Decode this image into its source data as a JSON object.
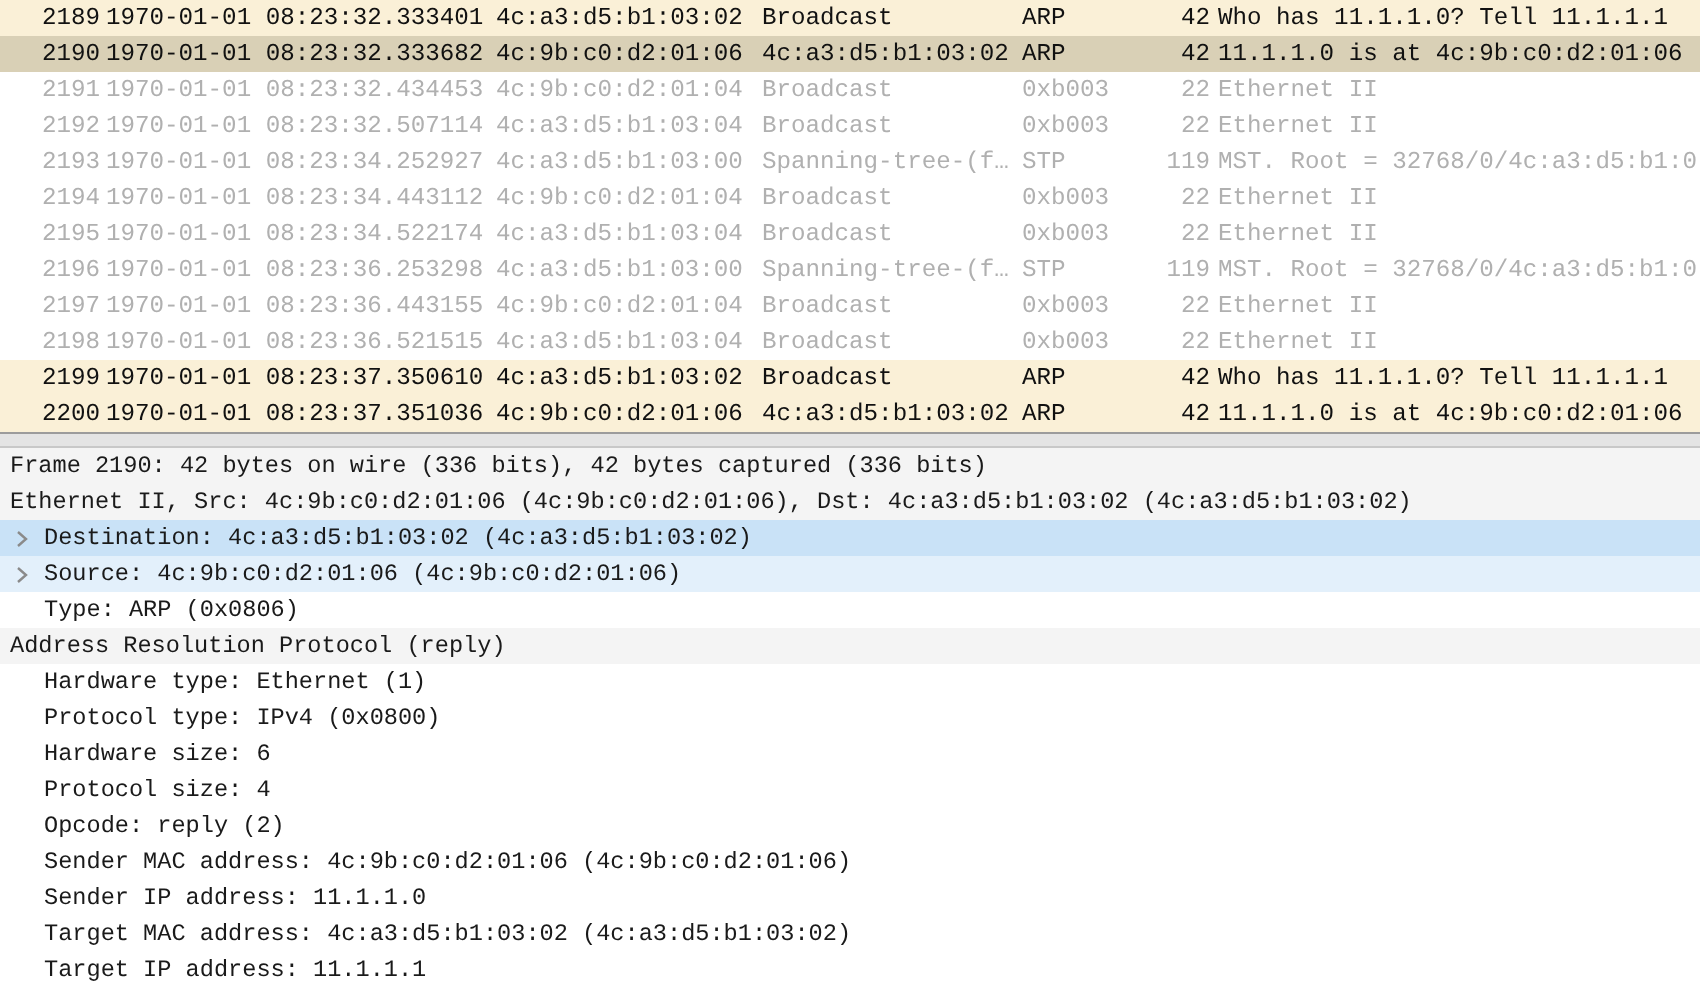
{
  "packet_list": {
    "rows": [
      {
        "no": "2189",
        "time": "1970-01-01 08:23:32.333401",
        "source": "4c:a3:d5:b1:03:02",
        "destination": "Broadcast",
        "protocol": "ARP",
        "length": "42",
        "info": "Who has 11.1.1.0? Tell 11.1.1.1",
        "kind": "arp",
        "selected": false
      },
      {
        "no": "2190",
        "time": "1970-01-01 08:23:32.333682",
        "source": "4c:9b:c0:d2:01:06",
        "destination": "4c:a3:d5:b1:03:02",
        "protocol": "ARP",
        "length": "42",
        "info": "11.1.1.0 is at 4c:9b:c0:d2:01:06",
        "kind": "arp",
        "selected": true
      },
      {
        "no": "2191",
        "time": "1970-01-01 08:23:32.434453",
        "source": "4c:9b:c0:d2:01:04",
        "destination": "Broadcast",
        "protocol": "0xb003",
        "length": "22",
        "info": "Ethernet II",
        "kind": "other",
        "selected": false
      },
      {
        "no": "2192",
        "time": "1970-01-01 08:23:32.507114",
        "source": "4c:a3:d5:b1:03:04",
        "destination": "Broadcast",
        "protocol": "0xb003",
        "length": "22",
        "info": "Ethernet II",
        "kind": "other",
        "selected": false
      },
      {
        "no": "2193",
        "time": "1970-01-01 08:23:34.252927",
        "source": "4c:a3:d5:b1:03:00",
        "destination": "Spanning-tree-(f…",
        "protocol": "STP",
        "length": "119",
        "info": "MST. Root = 32768/0/4c:a3:d5:b1:0",
        "kind": "other",
        "selected": false
      },
      {
        "no": "2194",
        "time": "1970-01-01 08:23:34.443112",
        "source": "4c:9b:c0:d2:01:04",
        "destination": "Broadcast",
        "protocol": "0xb003",
        "length": "22",
        "info": "Ethernet II",
        "kind": "other",
        "selected": false
      },
      {
        "no": "2195",
        "time": "1970-01-01 08:23:34.522174",
        "source": "4c:a3:d5:b1:03:04",
        "destination": "Broadcast",
        "protocol": "0xb003",
        "length": "22",
        "info": "Ethernet II",
        "kind": "other",
        "selected": false
      },
      {
        "no": "2196",
        "time": "1970-01-01 08:23:36.253298",
        "source": "4c:a3:d5:b1:03:00",
        "destination": "Spanning-tree-(f…",
        "protocol": "STP",
        "length": "119",
        "info": "MST. Root = 32768/0/4c:a3:d5:b1:0",
        "kind": "other",
        "selected": false
      },
      {
        "no": "2197",
        "time": "1970-01-01 08:23:36.443155",
        "source": "4c:9b:c0:d2:01:04",
        "destination": "Broadcast",
        "protocol": "0xb003",
        "length": "22",
        "info": "Ethernet II",
        "kind": "other",
        "selected": false
      },
      {
        "no": "2198",
        "time": "1970-01-01 08:23:36.521515",
        "source": "4c:a3:d5:b1:03:04",
        "destination": "Broadcast",
        "protocol": "0xb003",
        "length": "22",
        "info": "Ethernet II",
        "kind": "other",
        "selected": false
      },
      {
        "no": "2199",
        "time": "1970-01-01 08:23:37.350610",
        "source": "4c:a3:d5:b1:03:02",
        "destination": "Broadcast",
        "protocol": "ARP",
        "length": "42",
        "info": "Who has 11.1.1.0? Tell 11.1.1.1",
        "kind": "arp",
        "selected": false
      },
      {
        "no": "2200",
        "time": "1970-01-01 08:23:37.351036",
        "source": "4c:9b:c0:d2:01:06",
        "destination": "4c:a3:d5:b1:03:02",
        "protocol": "ARP",
        "length": "42",
        "info": "11.1.1.0 is at 4c:9b:c0:d2:01:06",
        "kind": "arp",
        "selected": false
      }
    ]
  },
  "packet_details": [
    {
      "label": "Frame 2190: 42 bytes on wire (336 bits), 42 bytes captured (336 bits)",
      "selected": false
    },
    {
      "label": "Ethernet II, Src: 4c:9b:c0:d2:01:06 (4c:9b:c0:d2:01:06), Dst: 4c:a3:d5:b1:03:02 (4c:a3:d5:b1:03:02)",
      "selected": false,
      "children": [
        {
          "label": "Destination: 4c:a3:d5:b1:03:02 (4c:a3:d5:b1:03:02)",
          "selected": true,
          "expandable": true
        },
        {
          "label": "Source: 4c:9b:c0:d2:01:06 (4c:9b:c0:d2:01:06)",
          "selected": false,
          "highlighted": true,
          "expandable": true
        },
        {
          "label": "Type: ARP (0x0806)",
          "selected": false
        }
      ]
    },
    {
      "label": "Address Resolution Protocol (reply)",
      "selected": false,
      "children": [
        {
          "label": "Hardware type: Ethernet (1)",
          "selected": false
        },
        {
          "label": "Protocol type: IPv4 (0x0800)",
          "selected": false
        },
        {
          "label": "Hardware size: 6",
          "selected": false
        },
        {
          "label": "Protocol size: 4",
          "selected": false
        },
        {
          "label": "Opcode: reply (2)",
          "selected": false
        },
        {
          "label": "Sender MAC address: 4c:9b:c0:d2:01:06 (4c:9b:c0:d2:01:06)",
          "selected": false
        },
        {
          "label": "Sender IP address: 11.1.1.0",
          "selected": false
        },
        {
          "label": "Target MAC address: 4c:a3:d5:b1:03:02 (4c:a3:d5:b1:03:02)",
          "selected": false
        },
        {
          "label": "Target IP address: 11.1.1.1",
          "selected": false
        }
      ]
    }
  ]
}
